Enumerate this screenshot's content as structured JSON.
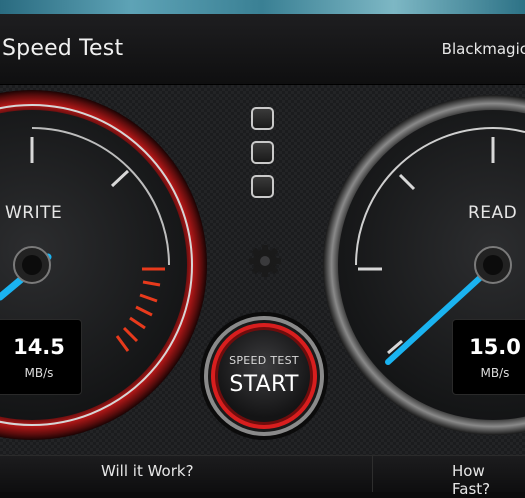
{
  "window": {
    "title": "Speed Test",
    "brand": "Blackmagic"
  },
  "write_gauge": {
    "label": "WRITE",
    "value": "14.5",
    "unit": "MB/s"
  },
  "read_gauge": {
    "label": "READ",
    "value": "15.0",
    "unit": "MB/s"
  },
  "start_button": {
    "top_text": "SPEED TEST",
    "main_text": "START"
  },
  "bottom": {
    "left_label": "Will it Work?",
    "right_label": "How Fast?"
  },
  "colors": {
    "needle": "#1ab3f0",
    "accent_red": "#c21c1c",
    "redline": "#ff3b1f"
  }
}
